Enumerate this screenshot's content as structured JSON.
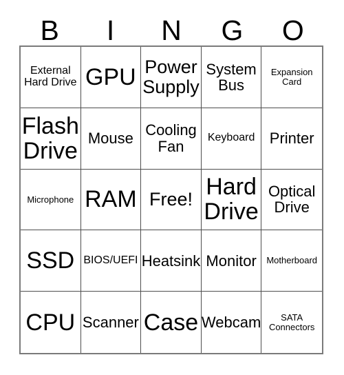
{
  "card": {
    "title_letters": [
      "B",
      "I",
      "N",
      "G",
      "O"
    ],
    "columns": 5,
    "rows": 5,
    "free_space_label": "Free!",
    "colors": {
      "background": "#ffffff",
      "text": "#000000",
      "inner_border": "#4d4d4d",
      "outer_border": "#7a7a7a"
    },
    "cells": [
      {
        "label": "External Hard Drive",
        "size": "sm"
      },
      {
        "label": "GPU",
        "size": "xl"
      },
      {
        "label": "Power Supply",
        "size": "lg"
      },
      {
        "label": "System Bus",
        "size": "md"
      },
      {
        "label": "Expansion Card",
        "size": "xs"
      },
      {
        "label": "Flash Drive",
        "size": "xl"
      },
      {
        "label": "Mouse",
        "size": "md"
      },
      {
        "label": "Cooling Fan",
        "size": "md"
      },
      {
        "label": "Keyboard",
        "size": "sm"
      },
      {
        "label": "Printer",
        "size": "md"
      },
      {
        "label": "Microphone",
        "size": "xs"
      },
      {
        "label": "RAM",
        "size": "xl"
      },
      {
        "label": "Free!",
        "size": "lg"
      },
      {
        "label": "Hard Drive",
        "size": "xl"
      },
      {
        "label": "Optical Drive",
        "size": "md"
      },
      {
        "label": "SSD",
        "size": "xl"
      },
      {
        "label": "BIOS/UEFI",
        "size": "sm"
      },
      {
        "label": "Heatsink",
        "size": "md"
      },
      {
        "label": "Monitor",
        "size": "md"
      },
      {
        "label": "Motherboard",
        "size": "xs"
      },
      {
        "label": "CPU",
        "size": "xl"
      },
      {
        "label": "Scanner",
        "size": "md"
      },
      {
        "label": "Case",
        "size": "xl"
      },
      {
        "label": "Webcam",
        "size": "md"
      },
      {
        "label": "SATA Connectors",
        "size": "xs"
      }
    ]
  }
}
